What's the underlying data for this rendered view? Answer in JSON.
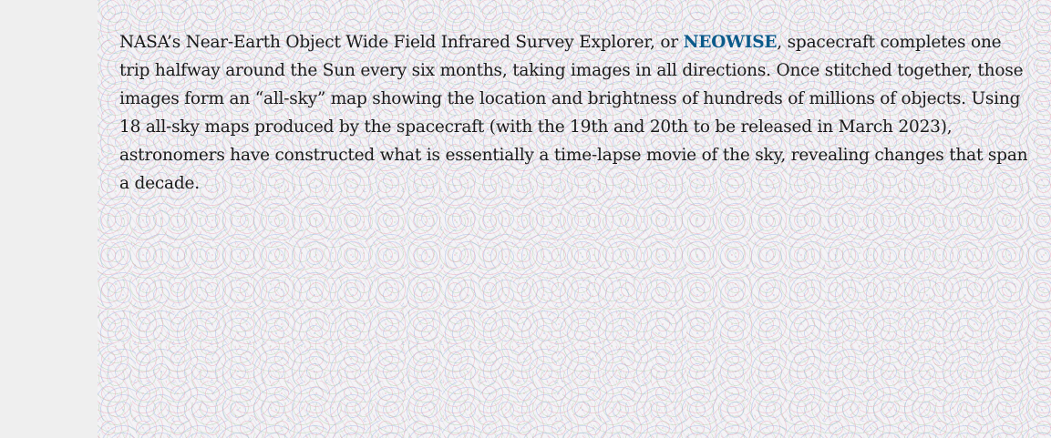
{
  "article": {
    "paragraph_before_link": "NASA’s Near-Earth Object Wide Field Infrared Survey Explorer, or ",
    "link_text": "NEOWISE",
    "paragraph_after_link": ", spacecraft completes one trip halfway around the Sun every six months, taking images in all directions. Once stitched together, those images form an “all-sky” map showing the location and brightness of hundreds of millions of objects. Using 18 all-sky maps produced by the spacecraft (with the 19th and 20th to be released in March 2023), astronomers have constructed what is essentially a time-lapse movie of the sky, revealing changes that span a decade."
  },
  "colors": {
    "gutter": "#efefef",
    "link": "#0b5a8a",
    "text": "#1a1a1a"
  }
}
